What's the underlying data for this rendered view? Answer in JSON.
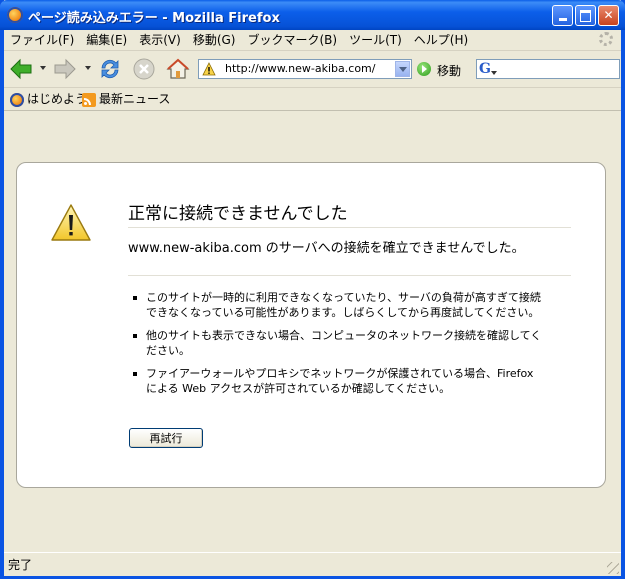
{
  "window": {
    "title": "ページ読み込みエラー - Mozilla Firefox"
  },
  "menu": {
    "items": [
      {
        "label": "ファイル(F)"
      },
      {
        "label": "編集(E)"
      },
      {
        "label": "表示(V)"
      },
      {
        "label": "移動(G)"
      },
      {
        "label": "ブックマーク(B)"
      },
      {
        "label": "ツール(T)"
      },
      {
        "label": "ヘルプ(H)"
      }
    ]
  },
  "nav": {
    "url": "http://www.new-akiba.com/",
    "go_label": "移動",
    "search_engine": "G",
    "search_value": ""
  },
  "bookmarks": {
    "items": [
      {
        "label": "はじめよう",
        "icon": "firefox-icon"
      },
      {
        "label": "最新ニュース",
        "icon": "rss-icon"
      }
    ]
  },
  "error": {
    "title": "正常に接続できませんでした",
    "description": "www.new-akiba.com のサーバへの接続を確立できませんでした。",
    "bullets": [
      "このサイトが一時的に利用できなくなっていたり、サーバの負荷が高すぎて接続できなくなっている可能性があります。しばらくしてから再度試してください。",
      "他のサイトも表示できない場合、コンピュータのネットワーク接続を確認してください。",
      "ファイアーウォールやプロキシでネットワークが保護されている場合、Firefox による Web アクセスが許可されているか確認してください。"
    ],
    "retry_label": "再試行"
  },
  "status": {
    "text": "完了"
  },
  "colors": {
    "titlebar": "#0a5ee8",
    "chrome": "#ece9d8",
    "warning": "#f7d34a"
  }
}
